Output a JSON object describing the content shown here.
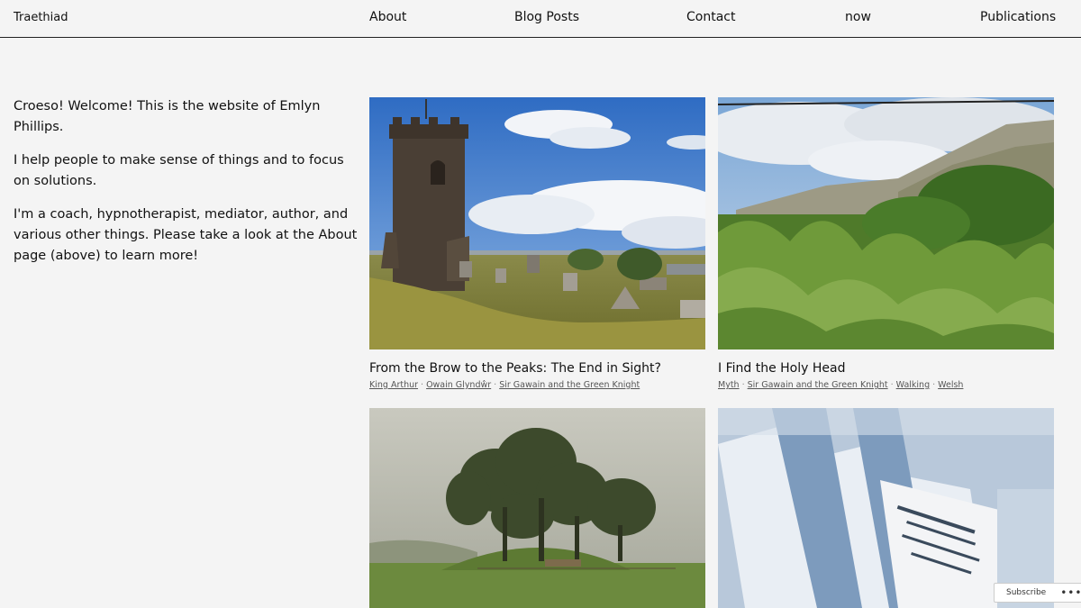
{
  "header": {
    "site_title": "Traethiad",
    "nav": [
      "About",
      "Blog Posts",
      "Contact",
      "now",
      "Publications"
    ]
  },
  "intro": {
    "paragraphs": [
      "Croeso! Welcome! This is the website of Emlyn Phillips.",
      "I help people to make sense of things and to focus on solutions.",
      "I'm a coach, hypnotherapist, mediator, author, and various other things. Please take a look at the About page (above) to learn more!"
    ]
  },
  "posts": [
    {
      "title": "From the Brow to the Peaks: The End in Sight?",
      "tags": [
        "King Arthur",
        "Owain Glyndŵr",
        "Sir Gawain and the Green Knight"
      ]
    },
    {
      "title": "I Find the Holy Head",
      "tags": [
        "Myth",
        "Sir Gawain and the Green Knight",
        "Walking",
        "Welsh"
      ]
    }
  ],
  "subscribe": {
    "label": "Subscribe",
    "more": "•••"
  },
  "colors": {
    "background": "#f4f4f4",
    "text": "#111111",
    "sky": "#3d78c9"
  }
}
